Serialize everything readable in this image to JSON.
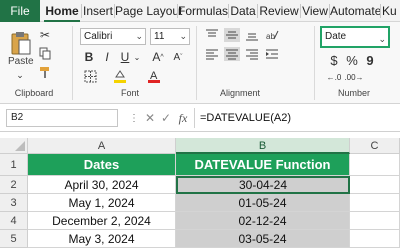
{
  "tabs": [
    "File",
    "Home",
    "Insert",
    "Page Layout",
    "Formulas",
    "Data",
    "Review",
    "View",
    "Automate",
    "Ku"
  ],
  "ribbon": {
    "clipboard": {
      "paste_label": "Paste",
      "group_label": "Clipboard"
    },
    "font": {
      "font_name": "Calibri",
      "font_size": "11",
      "group_label": "Font"
    },
    "alignment": {
      "group_label": "Alignment"
    },
    "number": {
      "format": "Date",
      "currency": "$",
      "percent": "%",
      "comma": "9",
      "group_label": "Number"
    }
  },
  "formula_bar": {
    "name_box": "B2",
    "fx": "fx",
    "formula": "=DATEVALUE(A2)"
  },
  "sheet": {
    "columns": [
      "A",
      "B",
      "C"
    ],
    "rows": [
      "1",
      "2",
      "3",
      "4",
      "5"
    ],
    "header": {
      "a": "Dates",
      "b": "DATEVALUE Function"
    },
    "data": [
      {
        "a": "April 30, 2024",
        "b": "30-04-24"
      },
      {
        "a": "May 1, 2024",
        "b": "01-05-24"
      },
      {
        "a": "December 2, 2024",
        "b": "02-12-24"
      },
      {
        "a": "May 3, 2024",
        "b": "03-05-24"
      }
    ]
  },
  "colors": {
    "accent": "#217346",
    "header_fill": "#1ea05a",
    "selected_fill": "#cfcfcf"
  }
}
